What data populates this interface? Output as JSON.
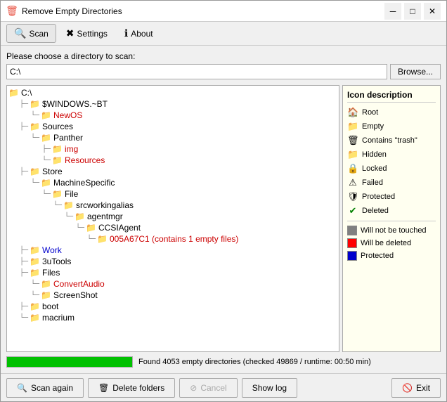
{
  "window": {
    "title": "Remove Empty Directories",
    "icon": "🗑"
  },
  "toolbar": {
    "scan_label": "Scan",
    "settings_label": "Settings",
    "about_label": "About"
  },
  "dir_section": {
    "label": "Please choose a directory to scan:",
    "value": "C:\\",
    "browse_label": "Browse..."
  },
  "tree": {
    "items": [
      {
        "indent": 0,
        "prefix": "",
        "icon": "📁",
        "text": "C:\\",
        "color": "normal"
      },
      {
        "indent": 1,
        "prefix": "├─",
        "icon": "📁",
        "text": "$WINDOWS.~BT",
        "color": "normal"
      },
      {
        "indent": 2,
        "prefix": "└─",
        "icon": "📁",
        "text": "NewOS",
        "color": "red"
      },
      {
        "indent": 1,
        "prefix": "├─",
        "icon": "📁",
        "text": "Sources",
        "color": "normal"
      },
      {
        "indent": 2,
        "prefix": "└─",
        "icon": "📁",
        "text": "Panther",
        "color": "normal"
      },
      {
        "indent": 3,
        "prefix": "├─",
        "icon": "📁",
        "text": "img",
        "color": "red"
      },
      {
        "indent": 3,
        "prefix": "└─",
        "icon": "📁",
        "text": "Resources",
        "color": "red"
      },
      {
        "indent": 1,
        "prefix": "├─",
        "icon": "📁",
        "text": "Store",
        "color": "normal"
      },
      {
        "indent": 2,
        "prefix": "└─",
        "icon": "📁",
        "text": "MachineSpecific",
        "color": "normal"
      },
      {
        "indent": 3,
        "prefix": "└─",
        "icon": "📁",
        "text": "File",
        "color": "normal"
      },
      {
        "indent": 4,
        "prefix": "└─",
        "icon": "📁",
        "text": "srcworkingalias",
        "color": "normal"
      },
      {
        "indent": 5,
        "prefix": "└─",
        "icon": "📁",
        "text": "agentmgr",
        "color": "normal"
      },
      {
        "indent": 6,
        "prefix": "└─",
        "icon": "📁",
        "text": "CCSIAgent",
        "color": "normal"
      },
      {
        "indent": 7,
        "prefix": "└─",
        "icon": "📁",
        "text": "005A67C1 (contains 1 empty files)",
        "color": "red"
      },
      {
        "indent": 1,
        "prefix": "├─",
        "icon": "📁",
        "text": "Work",
        "color": "blue"
      },
      {
        "indent": 1,
        "prefix": "├─",
        "icon": "📁",
        "text": "3uTools",
        "color": "normal"
      },
      {
        "indent": 1,
        "prefix": "├─",
        "icon": "📁",
        "text": "Files",
        "color": "normal"
      },
      {
        "indent": 2,
        "prefix": "└─",
        "icon": "📁",
        "text": "ConvertAudio",
        "color": "red"
      },
      {
        "indent": 2,
        "prefix": "└─",
        "icon": "📁",
        "text": "ScreenShot",
        "color": "normal"
      },
      {
        "indent": 1,
        "prefix": "├─",
        "icon": "📁",
        "text": "boot",
        "color": "normal"
      },
      {
        "indent": 1,
        "prefix": "└─",
        "icon": "📁",
        "text": "macrium",
        "color": "normal"
      }
    ]
  },
  "legend": {
    "title": "Icon description",
    "items": [
      {
        "icon": "🏠",
        "label": "Root"
      },
      {
        "icon": "📁",
        "label": "Empty"
      },
      {
        "icon": "🗑",
        "label": "Contains \"trash\""
      },
      {
        "icon": "🔒",
        "label": "Hidden"
      },
      {
        "icon": "🔒",
        "label": "Locked"
      },
      {
        "icon": "⚠",
        "label": "Failed"
      },
      {
        "icon": "🛡",
        "label": "Protected"
      },
      {
        "icon": "✔",
        "label": "Deleted"
      }
    ],
    "colors": [
      {
        "color": "#808080",
        "label": "Will not be touched"
      },
      {
        "color": "#ff0000",
        "label": "Will be deleted"
      },
      {
        "color": "#0000cc",
        "label": "Protected"
      }
    ]
  },
  "progress": {
    "percent": 100,
    "text": "Found 4053 empty directories (checked 49869 / runtime: 00:50 min)"
  },
  "actions": {
    "scan_again": "Scan again",
    "delete_folders": "Delete folders",
    "cancel": "Cancel",
    "show_log": "Show log",
    "exit": "Exit"
  }
}
